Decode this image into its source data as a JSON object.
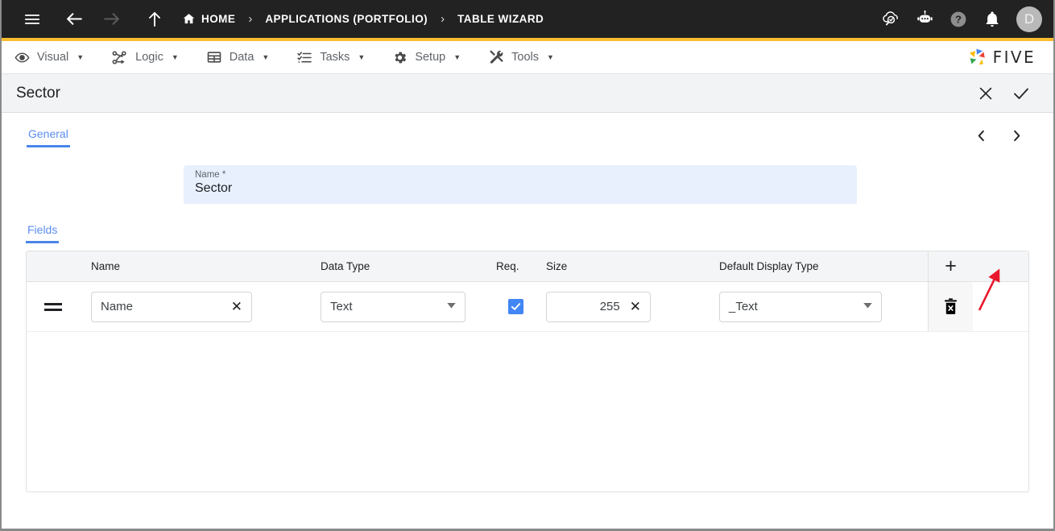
{
  "topbar": {
    "menu_icon": "hamburger-icon",
    "back_icon": "arrow-left-icon",
    "forward_icon": "arrow-right-icon",
    "up_icon": "arrow-up-icon",
    "breadcrumbs": [
      {
        "label": "HOME",
        "icon": "home-icon"
      },
      {
        "label": "APPLICATIONS (PORTFOLIO)",
        "icon": ""
      },
      {
        "label": "TABLE WIZARD",
        "icon": ""
      }
    ],
    "separator": "›",
    "right_icons": [
      {
        "name": "cloud-search-icon"
      },
      {
        "name": "chatbot-icon"
      },
      {
        "name": "help-icon"
      },
      {
        "name": "notifications-bell-icon"
      }
    ],
    "avatar_initial": "D",
    "accent_rule_color": "#FBBC2E"
  },
  "menubar": {
    "items": [
      {
        "label": "Visual",
        "icon": "eye-icon"
      },
      {
        "label": "Logic",
        "icon": "flow-nodes-icon"
      },
      {
        "label": "Data",
        "icon": "table-grid-icon"
      },
      {
        "label": "Tasks",
        "icon": "checklist-icon"
      },
      {
        "label": "Setup",
        "icon": "gear-icon"
      },
      {
        "label": "Tools",
        "icon": "tools-icon"
      }
    ],
    "caret": "▼",
    "brand": "FIVE",
    "brand_colors": [
      "#4285F4",
      "#EA4335",
      "#FBBC05",
      "#34A853"
    ]
  },
  "record": {
    "title": "Sector",
    "cancel_icon": "close-icon",
    "save_icon": "check-icon"
  },
  "general": {
    "tab_label": "General",
    "prev_icon": "‹",
    "next_icon": "›",
    "name_field": {
      "label": "Name *",
      "value": "Sector",
      "placeholder": "Name"
    }
  },
  "fields": {
    "tab_label": "Fields",
    "columns": [
      "Name",
      "Data Type",
      "Req.",
      "Size",
      "Default Display Type"
    ],
    "add_icon": "plus-icon",
    "rows": [
      {
        "drag_handle": "drag-handle-icon",
        "name": "Name",
        "name_clear_icon": "✕",
        "data_type": "Text",
        "required": true,
        "size": "255",
        "size_clear_icon": "✕",
        "default_display_type": "_Text",
        "delete_icon": "delete-icon"
      }
    ]
  },
  "annotation": {
    "arrow_color": "#E8192C",
    "points_to": "add-row-button"
  }
}
